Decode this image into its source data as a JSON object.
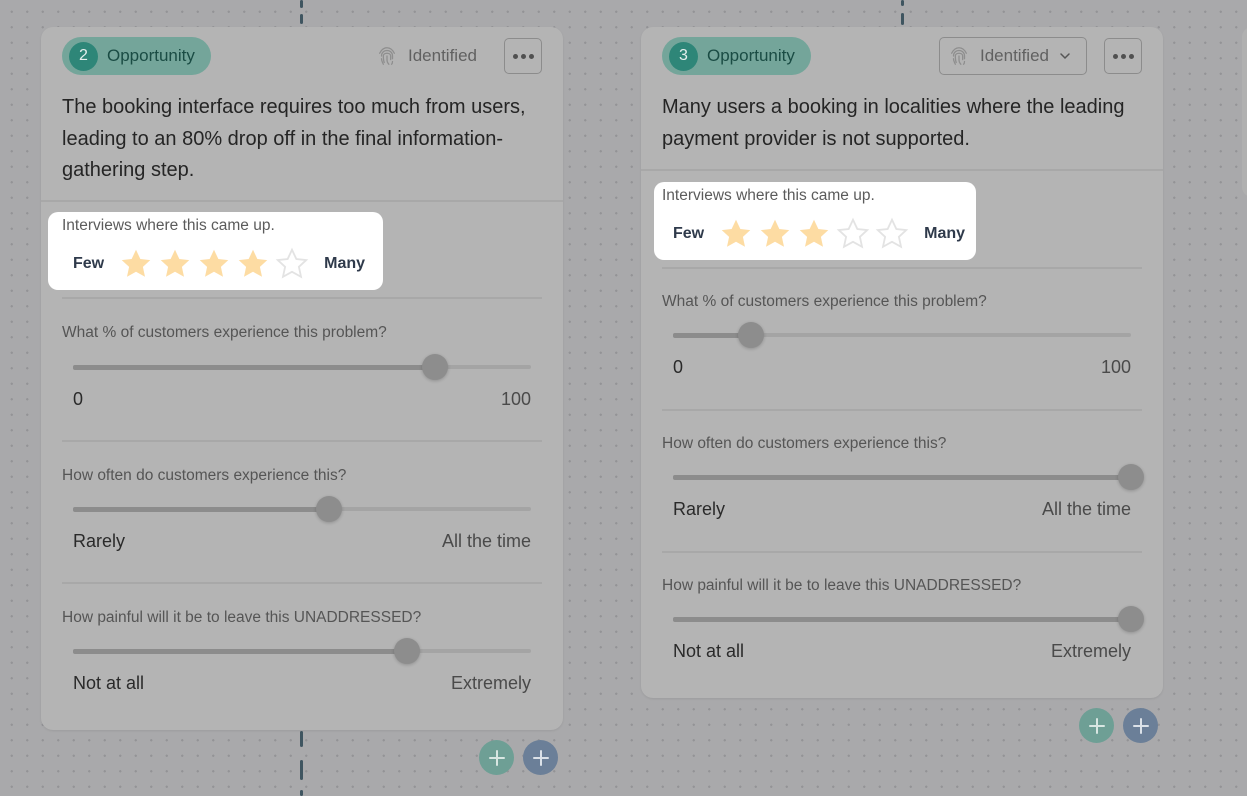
{
  "cards": [
    {
      "number": "2",
      "type_label": "Opportunity",
      "status": "Identified",
      "status_has_dropdown": false,
      "description": "The booking interface requires too much from users, leading to an 80% drop off in the final information-gathering step.",
      "rating": {
        "title": "Interviews where this came up.",
        "min_label": "Few",
        "max_label": "Many",
        "value": 4,
        "max": 5
      },
      "questions": [
        {
          "label": "What % of customers experience this problem?",
          "min_label": "0",
          "max_label": "100",
          "value": 0.79
        },
        {
          "label": "How often do customers experience this?",
          "min_label": "Rarely",
          "max_label": "All the time",
          "value": 0.56
        },
        {
          "label": "How painful will it be to leave this UNADDRESSED?",
          "min_label": "Not at all",
          "max_label": "Extremely",
          "value": 0.73
        }
      ]
    },
    {
      "number": "3",
      "type_label": "Opportunity",
      "status": "Identified",
      "status_has_dropdown": true,
      "description": "Many users a booking in localities where the leading payment provider is not supported.",
      "rating": {
        "title": "Interviews where this came up.",
        "min_label": "Few",
        "max_label": "Many",
        "value": 3,
        "max": 5
      },
      "questions": [
        {
          "label": "What % of customers experience this problem?",
          "min_label": "0",
          "max_label": "100",
          "value": 0.17
        },
        {
          "label": "How often do customers experience this?",
          "min_label": "Rarely",
          "max_label": "All the time",
          "value": 1.0
        },
        {
          "label": "How painful will it be to leave this UNADDRESSED?",
          "min_label": "Not at all",
          "max_label": "Extremely",
          "value": 1.0
        }
      ]
    }
  ],
  "icons": {
    "status": "fingerprint-icon",
    "more": "more-horizontal-icon",
    "add": "plus-icon",
    "dropdown": "chevron-down-icon",
    "star": "star-icon"
  },
  "colors": {
    "star_filled": "#fddca3",
    "star_empty": "#e3e3e3",
    "pill_bg": "#74a59a",
    "pill_num_bg": "#2e8678",
    "add_green": "#6e9f95",
    "add_blue": "#6b7f98",
    "connector": "#3f5560"
  }
}
